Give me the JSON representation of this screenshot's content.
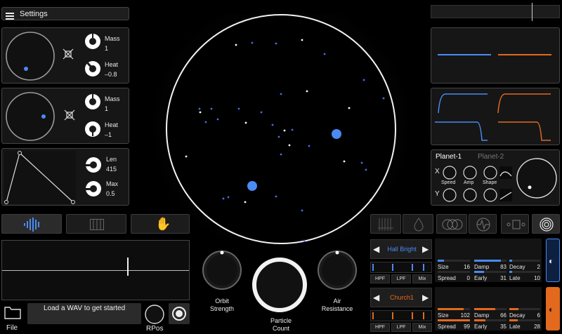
{
  "header": {
    "title": "Settings"
  },
  "planets": [
    {
      "mass_label": "Mass",
      "mass_value": "1",
      "heat_label": "Heat",
      "heat_value": "–0.8"
    },
    {
      "mass_label": "Mass",
      "mass_value": "1",
      "heat_label": "Heat",
      "heat_value": "–1"
    }
  ],
  "envelope": {
    "len_label": "Len",
    "len_value": "415",
    "max_label": "Max",
    "max_value": "0.5"
  },
  "planet_tabs": {
    "active": "Planet-1",
    "inactive": "Planet-2"
  },
  "lfo": {
    "x_label": "X",
    "y_label": "Y",
    "speed_label": "Speed",
    "amp_label": "Amp",
    "shape_label": "Shape"
  },
  "knobs": {
    "orbit_strength": "Orbit\nStrength",
    "particle_count": "Particle\nCount",
    "air_resistance": "Air\nResistance"
  },
  "file": {
    "label": "File",
    "message": "Load a WAV to get started",
    "rpos_label": "RPos"
  },
  "reverb": [
    {
      "preset": "Hall Bright",
      "accent": "#4a8af4",
      "filters": [
        "HPF",
        "LPF",
        "Mix"
      ],
      "params": [
        {
          "name": "Size",
          "value": "16",
          "fill": 0.2
        },
        {
          "name": "Damp",
          "value": "83",
          "fill": 0.83
        },
        {
          "name": "Decay",
          "value": "2",
          "fill": 0.1
        },
        {
          "name": "Spread",
          "value": "0",
          "fill": 0.0
        },
        {
          "name": "Early",
          "value": "31",
          "fill": 0.31
        },
        {
          "name": "Late",
          "value": "10",
          "fill": 0.1
        }
      ]
    },
    {
      "preset": "Church1",
      "accent": "#e2691e",
      "filters": [
        "HPF",
        "LPF",
        "Mix"
      ],
      "params": [
        {
          "name": "Size",
          "value": "102",
          "fill": 0.8
        },
        {
          "name": "Damp",
          "value": "66",
          "fill": 0.66
        },
        {
          "name": "Decay",
          "value": "6",
          "fill": 0.3
        },
        {
          "name": "Spread",
          "value": "99",
          "fill": 0.99
        },
        {
          "name": "Early",
          "value": "35",
          "fill": 0.35
        },
        {
          "name": "Late",
          "value": "28",
          "fill": 0.28
        }
      ]
    }
  ],
  "colors": {
    "blue": "#4a8af4",
    "orange": "#e2691e",
    "panel": "#161616"
  },
  "particles": [
    [
      336,
      64
    ],
    [
      359,
      61
    ],
    [
      393,
      62
    ],
    [
      430,
      57
    ],
    [
      462,
      77
    ],
    [
      400,
      134
    ],
    [
      437,
      130
    ],
    [
      518,
      114
    ],
    [
      546,
      140
    ],
    [
      285,
      160
    ],
    [
      301,
      155
    ],
    [
      340,
      155
    ],
    [
      350,
      175
    ],
    [
      293,
      174
    ],
    [
      372,
      160
    ],
    [
      497,
      154
    ],
    [
      310,
      170
    ],
    [
      388,
      178
    ],
    [
      405,
      186
    ],
    [
      416,
      185
    ],
    [
      397,
      195
    ],
    [
      412,
      207
    ],
    [
      440,
      208
    ],
    [
      400,
      220
    ],
    [
      265,
      223
    ],
    [
      515,
      232
    ],
    [
      521,
      242
    ],
    [
      490,
      230
    ],
    [
      325,
      281
    ],
    [
      318,
      283
    ],
    [
      349,
      288
    ],
    [
      430,
      300
    ],
    [
      393,
      280
    ],
    [
      528,
      285
    ],
    [
      433,
      343
    ],
    [
      284,
      155
    ]
  ]
}
